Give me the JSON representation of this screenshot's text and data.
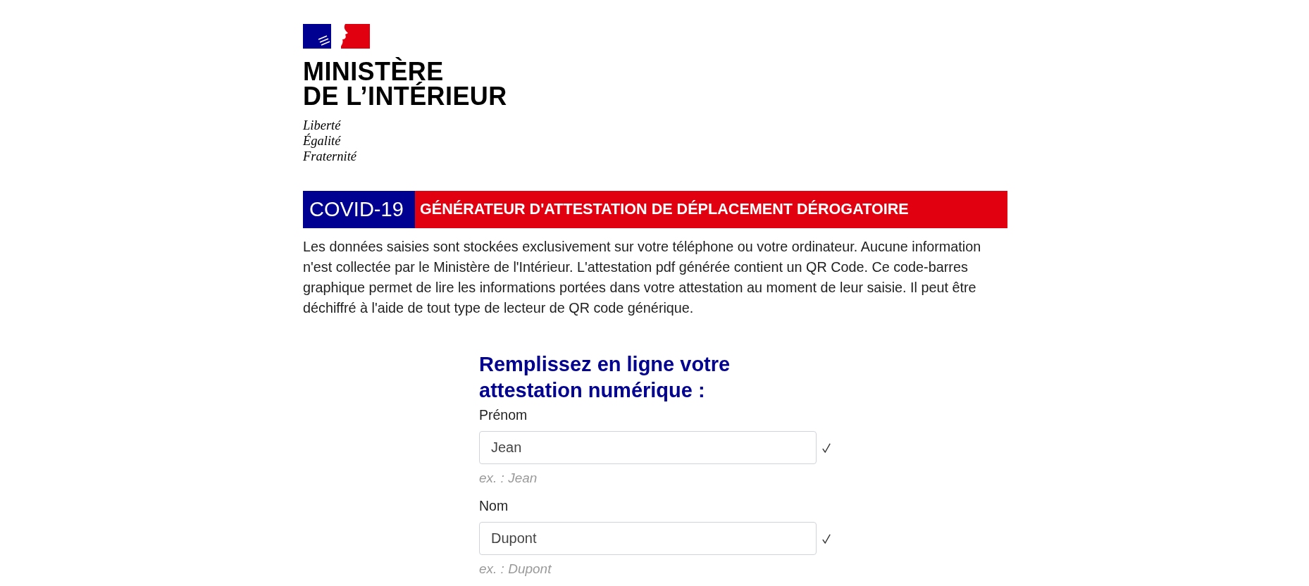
{
  "header": {
    "ministry_name": [
      "MINISTÈRE",
      "DE L’INTÉRIEUR"
    ],
    "motto": [
      "Liberté",
      "Égalité",
      "Fraternité"
    ]
  },
  "banner": {
    "tag": "COVID-19",
    "title": "GÉNÉRATEUR D'ATTESTATION DE DÉPLACEMENT DÉROGATOIRE"
  },
  "intro": "Les données saisies sont stockées exclusivement sur votre téléphone ou votre ordinateur. Aucune information n'est collectée par le Ministère de l'Intérieur. L'attestation pdf générée contient un QR Code. Ce code-barres graphique permet de lire les informations portées dans votre attestation au moment de leur saisie. Il peut être déchiffré à l'aide de tout type de lecteur de QR code générique.",
  "form": {
    "title": "Remplissez en ligne votre attestation numérique :",
    "fields": [
      {
        "label": "Prénom",
        "value": "Jean",
        "hint": "ex. : Jean",
        "valid": true
      },
      {
        "label": "Nom",
        "value": "Dupont",
        "hint": "ex. : Dupont",
        "valid": true
      }
    ]
  }
}
